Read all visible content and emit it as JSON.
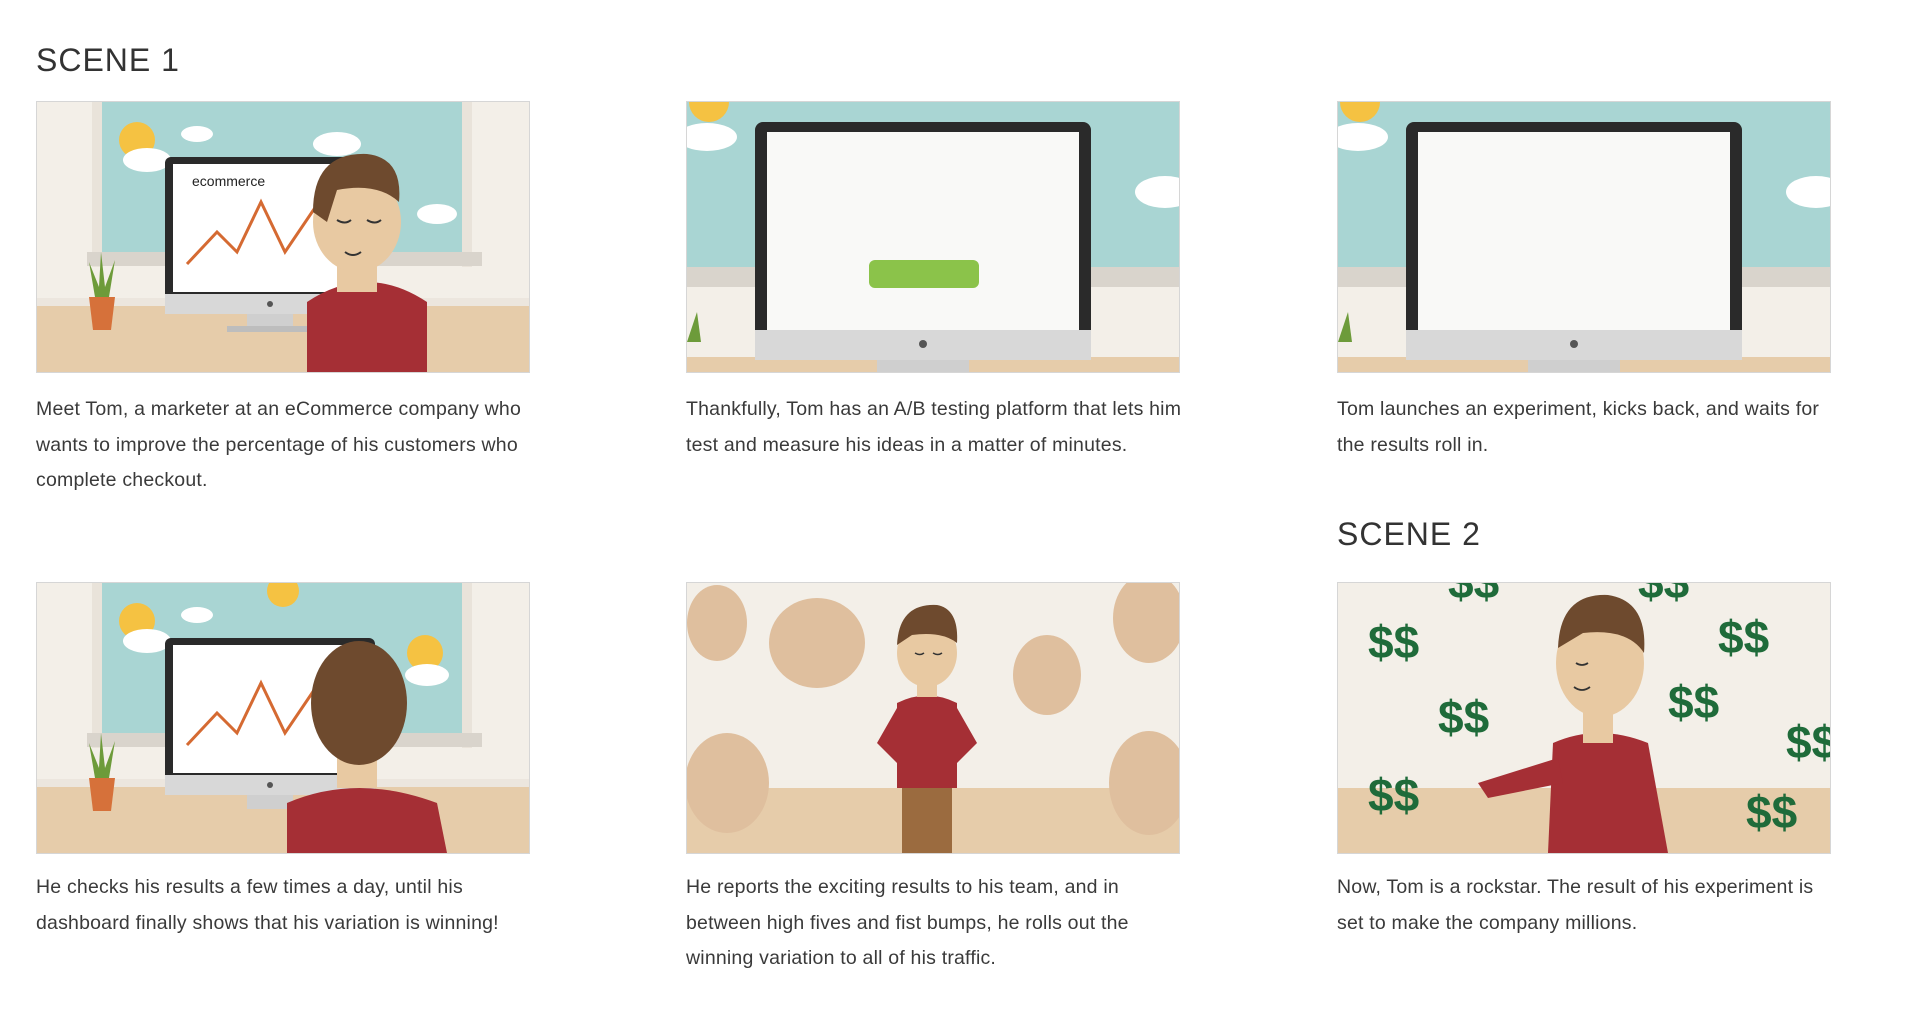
{
  "scenes": [
    {
      "heading": "SCENE 1"
    },
    {
      "heading": "SCENE 2"
    }
  ],
  "panels": [
    {
      "screen_text": "ecommerce",
      "caption": "Meet Tom, a marketer at an eCommerce company who wants to improve the percentage of his customers who complete checkout."
    },
    {
      "caption": "Thankfully, Tom has an A/B testing platform that lets him test and measure his ideas in a matter of minutes."
    },
    {
      "caption": "Tom launches an experiment, kicks back, and waits for the results roll in."
    },
    {
      "caption": "He checks his results a few times a day, until his dashboard finally shows that his variation is winning!"
    },
    {
      "caption": "He reports the exciting results to his team, and in between high fives and fist bumps, he rolls out the winning variation to all of his traffic."
    },
    {
      "caption": "Now, Tom is a rockstar. The result of his experiment is set to make the company millions."
    }
  ],
  "colors": {
    "sky": "#a9d5d3",
    "wall": "#f3efe8",
    "floor": "#e6ccaa",
    "sweater": "#a52f35",
    "hair": "#6e4a2e",
    "skin": "#e8c9a2",
    "button_green": "#8bc34a",
    "money_green": "#1f6b3a",
    "sun": "#f5c242"
  },
  "icons": [
    "sun-icon",
    "cloud-icon",
    "plant-icon",
    "monitor-icon",
    "dollar-icon",
    "hand-icon"
  ]
}
